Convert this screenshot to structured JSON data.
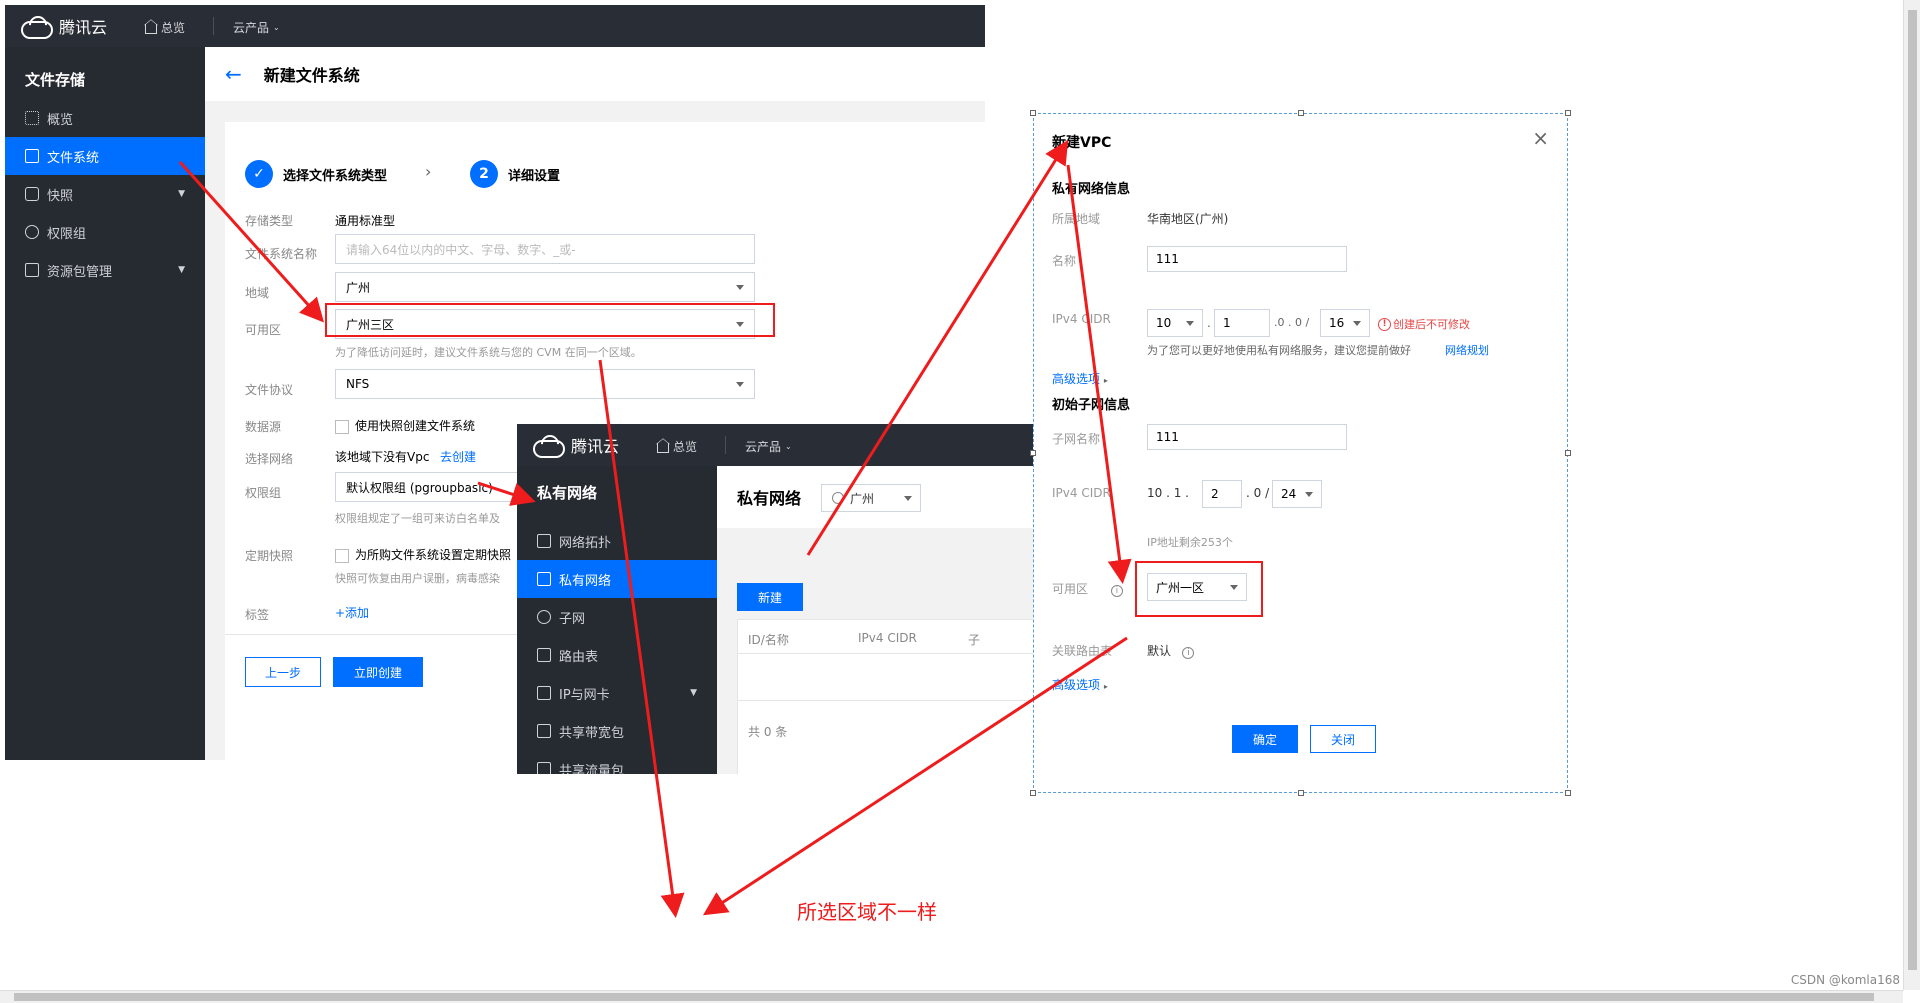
{
  "colors": {
    "brand": "#006eff",
    "annotation": "#ee1c1c",
    "sidebar": "#262a31",
    "topbar": "#292d35"
  },
  "cfs_window": {
    "topbar": {
      "brand": "腾讯云",
      "overview": "总览",
      "products": "云产品"
    },
    "sidebar": {
      "title": "文件存储",
      "items": [
        {
          "label": "概览",
          "icon": "grid-icon"
        },
        {
          "label": "文件系统",
          "icon": "folder-icon"
        },
        {
          "label": "快照",
          "icon": "camera-icon"
        },
        {
          "label": "权限组",
          "icon": "key-icon"
        },
        {
          "label": "资源包管理",
          "icon": "package-icon"
        }
      ]
    },
    "page_title": "新建文件系统",
    "steps": [
      {
        "label": "选择文件系统类型"
      },
      {
        "number": "2",
        "label": "详细设置"
      }
    ],
    "form": {
      "storage_type_label": "存储类型",
      "storage_type_value": "通用标准型",
      "name_label": "文件系统名称",
      "name_placeholder": "请输入64位以内的中文、字母、数字、_或-",
      "region_label": "地域",
      "region_value": "广州",
      "zone_label": "可用区",
      "zone_value": "广州三区",
      "zone_hint": "为了降低访问延时，建议文件系统与您的 CVM 在同一个区域。",
      "protocol_label": "文件协议",
      "protocol_value": "NFS",
      "datasource_label": "数据源",
      "datasource_text": "使用快照创建文件系统",
      "network_label": "选择网络",
      "network_text": "该地域下没有Vpc",
      "network_link": "去创建",
      "perm_label": "权限组",
      "perm_value": "默认权限组 (pgroupbasic)",
      "perm_hint": "权限组规定了一组可来访白名单及",
      "snapshot_label": "定期快照",
      "snapshot_text": "为所购文件系统设置定期快照",
      "snapshot_hint": "快照可恢复由用户误删，病毒感染",
      "tag_label": "标签",
      "tag_add": "+添加"
    },
    "buttons": {
      "prev": "上一步",
      "create": "立即创建"
    }
  },
  "vpc_window": {
    "topbar": {
      "brand": "腾讯云",
      "overview": "总览",
      "products": "云产品"
    },
    "sidebar": {
      "title": "私有网络",
      "items": [
        {
          "label": "网络拓扑",
          "icon": "topology-icon"
        },
        {
          "label": "私有网络",
          "icon": "lock-icon"
        },
        {
          "label": "子网",
          "icon": "globe-icon"
        },
        {
          "label": "路由表",
          "icon": "route-icon"
        },
        {
          "label": "IP与网卡",
          "icon": "nic-icon"
        },
        {
          "label": "共享带宽包",
          "icon": "bandwidth-icon"
        },
        {
          "label": "共享流量包",
          "icon": "traffic-icon"
        }
      ]
    },
    "page_title": "私有网络",
    "region": "广州",
    "new_button": "新建",
    "table": {
      "col1": "ID/名称",
      "col2": "IPv4 CIDR",
      "col3": "子",
      "total": "共  0  条"
    }
  },
  "dialog": {
    "title": "新建VPC",
    "vpc_section": "私有网络信息",
    "region_label": "所属地域",
    "region_value": "华南地区(广州)",
    "name_label": "名称",
    "name_value": "111",
    "cidr_label": "IPv4 CIDR",
    "cidr_parts": [
      "10",
      "1",
      ".0 . 0 /",
      "16"
    ],
    "cidr_warning": "创建后不可修改",
    "cidr_hint": "为了您可以更好地使用私有网络服务，建议您提前做好",
    "cidr_hint_link": "网络规划",
    "advanced1": "高级选项",
    "subnet_section": "初始子网信息",
    "subnet_name_label": "子网名称",
    "subnet_name_value": "111",
    "subnet_cidr_label": "IPv4 CIDR",
    "subnet_cidr_prefix": "10 . 1 .",
    "subnet_cidr_third": "2",
    "subnet_cidr_mid": ". 0 /",
    "subnet_cidr_mask": "24",
    "ip_remaining": "IP地址剩余253个",
    "zone_label": "可用区",
    "zone_value": "广州一区",
    "route_label": "关联路由表",
    "route_value": "默认",
    "advanced2": "高级选项",
    "ok": "确定",
    "close": "关闭"
  },
  "annotation": {
    "text": "所选区域不一样"
  },
  "watermark": "CSDN @komla168"
}
